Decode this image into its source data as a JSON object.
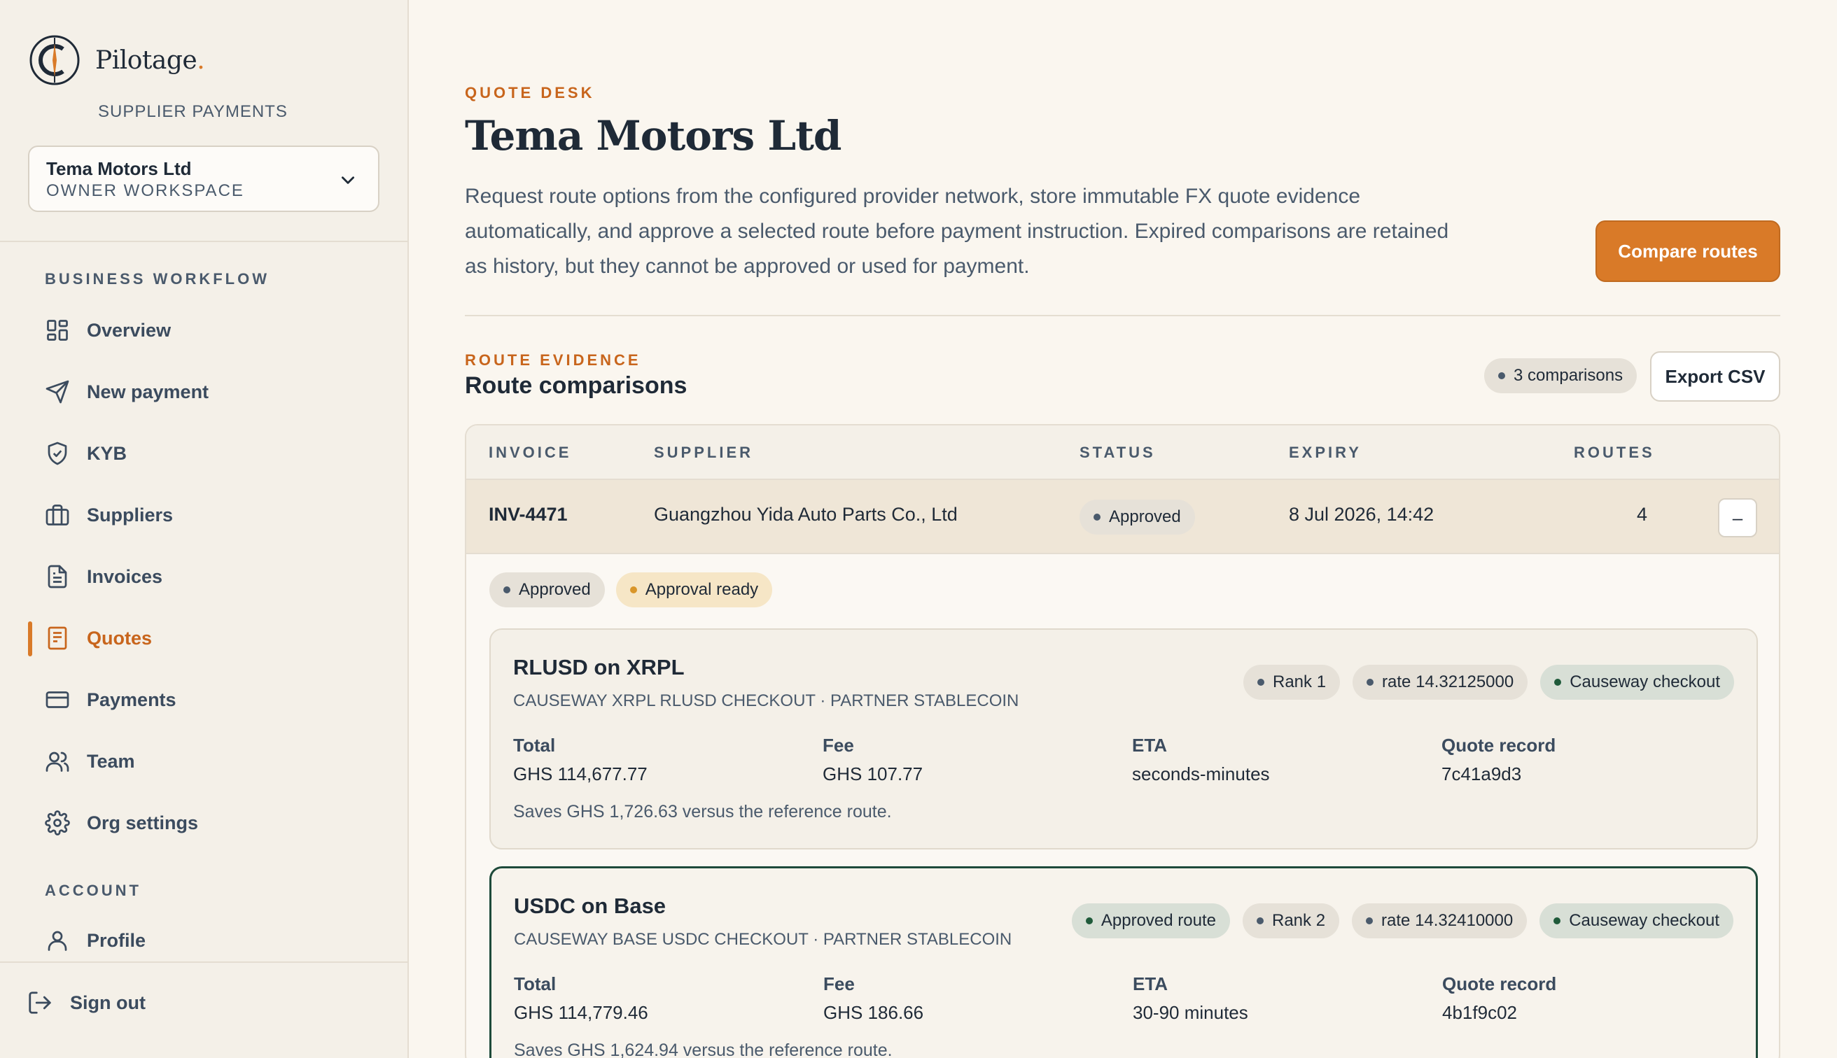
{
  "brand": {
    "name": "Pilotage",
    "dot": ".",
    "subtitle": "SUPPLIER PAYMENTS"
  },
  "workspace": {
    "name": "Tema Motors Ltd",
    "role": "OWNER WORKSPACE"
  },
  "sidebar": {
    "section_workflow": "BUSINESS WORKFLOW",
    "items": [
      {
        "label": "Overview",
        "icon": "grid-icon"
      },
      {
        "label": "New payment",
        "icon": "send-icon"
      },
      {
        "label": "KYB",
        "icon": "shield-check-icon"
      },
      {
        "label": "Suppliers",
        "icon": "briefcase-icon"
      },
      {
        "label": "Invoices",
        "icon": "document-icon"
      },
      {
        "label": "Quotes",
        "icon": "receipt-icon",
        "active": true
      },
      {
        "label": "Payments",
        "icon": "card-icon"
      },
      {
        "label": "Team",
        "icon": "users-icon"
      },
      {
        "label": "Org settings",
        "icon": "gear-icon"
      }
    ],
    "section_account": "ACCOUNT",
    "account_items": [
      {
        "label": "Profile",
        "icon": "user-icon"
      }
    ],
    "signout": "Sign out"
  },
  "header": {
    "eyebrow": "QUOTE DESK",
    "title": "Tema Motors Ltd",
    "description": "Request route options from the configured provider network, store immutable FX quote evidence automatically, and approve a selected route before payment instruction. Expired comparisons are retained as history, but they cannot be approved or used for payment.",
    "compare_button": "Compare routes"
  },
  "comparisons": {
    "eyebrow": "ROUTE EVIDENCE",
    "title": "Route comparisons",
    "count_label": "3 comparisons",
    "export_button": "Export CSV",
    "columns": [
      "INVOICE",
      "SUPPLIER",
      "STATUS",
      "EXPIRY",
      "ROUTES"
    ],
    "row": {
      "invoice": "INV-4471",
      "supplier": "Guangzhou Yida Auto Parts Co., Ltd",
      "status": "Approved",
      "expiry": "8 Jul 2026, 14:42",
      "routes": "4",
      "collapse": "–"
    },
    "detail_pills": [
      "Approved",
      "Approval ready"
    ],
    "routes": [
      {
        "title": "RLUSD on XRPL",
        "subtitle": "CAUSEWAY XRPL RLUSD CHECKOUT · PARTNER STABLECOIN",
        "pills": [
          "Rank 1",
          "rate 14.32125000",
          "Causeway checkout"
        ],
        "total_label": "Total",
        "total": "GHS 114,677.77",
        "fee_label": "Fee",
        "fee": "GHS 107.77",
        "eta_label": "ETA",
        "eta": "seconds-minutes",
        "record_label": "Quote record",
        "record": "7c41a9d3",
        "note": "Saves GHS 1,726.63 versus the reference route."
      },
      {
        "title": "USDC on Base",
        "subtitle": "CAUSEWAY BASE USDC CHECKOUT · PARTNER STABLECOIN",
        "pills": [
          "Approved route",
          "Rank 2",
          "rate 14.32410000",
          "Causeway checkout"
        ],
        "total_label": "Total",
        "total": "GHS 114,779.46",
        "fee_label": "Fee",
        "fee": "GHS 186.66",
        "eta_label": "ETA",
        "eta": "30-90 minutes",
        "record_label": "Quote record",
        "record": "4b1f9c02",
        "note": "Saves GHS 1,624.94 versus the reference route."
      }
    ]
  },
  "colors": {
    "accent": "#d97a28",
    "approved_green": "#1e4a3a",
    "background": "#faf6ef",
    "sidebar": "#f4f0e8"
  }
}
